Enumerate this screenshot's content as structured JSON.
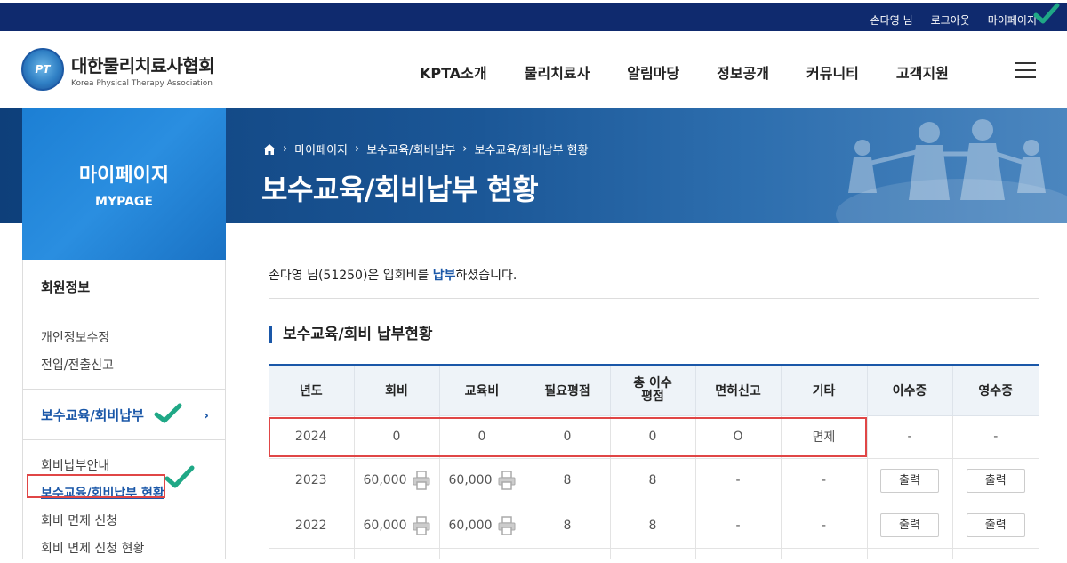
{
  "topbar": {
    "user": "손다영 님",
    "logout": "로그아웃",
    "mypage": "마이페이지"
  },
  "header": {
    "logo_mark": "PT",
    "logo_ko": "대한물리치료사협회",
    "logo_en": "Korea Physical Therapy Association",
    "nav": [
      "KPTA소개",
      "물리치료사",
      "알림마당",
      "정보공개",
      "커뮤니티",
      "고객지원"
    ]
  },
  "banner": {
    "breadcrumb": [
      "마이페이지",
      "보수교육/회비납부",
      "보수교육/회비납부 현황"
    ],
    "title": "보수교육/회비납부 현황"
  },
  "sidebar": {
    "title": "마이페이지",
    "subtitle": "MYPAGE",
    "section": "회원정보",
    "section_items": [
      "개인정보수정",
      "전입/전출신고"
    ],
    "active_section": "보수교육/회비납부",
    "active_items": [
      "회비납부안내",
      "보수교육/회비납부 현황",
      "회비 면제 신청",
      "회비 면제 신청 현황"
    ]
  },
  "content": {
    "notice_pre": "손다영 님(51250)은 입회비를 ",
    "notice_hl": "납부",
    "notice_post": "하셨습니다.",
    "section_title": "보수교육/회비 납부현황",
    "columns": [
      "년도",
      "회비",
      "교육비",
      "필요평점",
      "총 이수\n평점",
      "면허신고",
      "기타",
      "이수증",
      "영수증"
    ],
    "rows": [
      {
        "year": "2024",
        "fee": "0",
        "edu": "0",
        "req": "0",
        "total": "0",
        "license": "O",
        "etc": "면제",
        "cert": "-",
        "receipt": "-"
      },
      {
        "year": "2023",
        "fee": "60,000",
        "edu": "60,000",
        "req": "8",
        "total": "8",
        "license": "-",
        "etc": "-",
        "cert": "출력",
        "receipt": "출력"
      },
      {
        "year": "2022",
        "fee": "60,000",
        "edu": "60,000",
        "req": "8",
        "total": "8",
        "license": "-",
        "etc": "-",
        "cert": "출력",
        "receipt": "출력"
      }
    ]
  },
  "colors": {
    "navy": "#0f2a6e",
    "accent": "#1a57a8",
    "highlight_box": "#e04646",
    "check": "#1fa886"
  }
}
